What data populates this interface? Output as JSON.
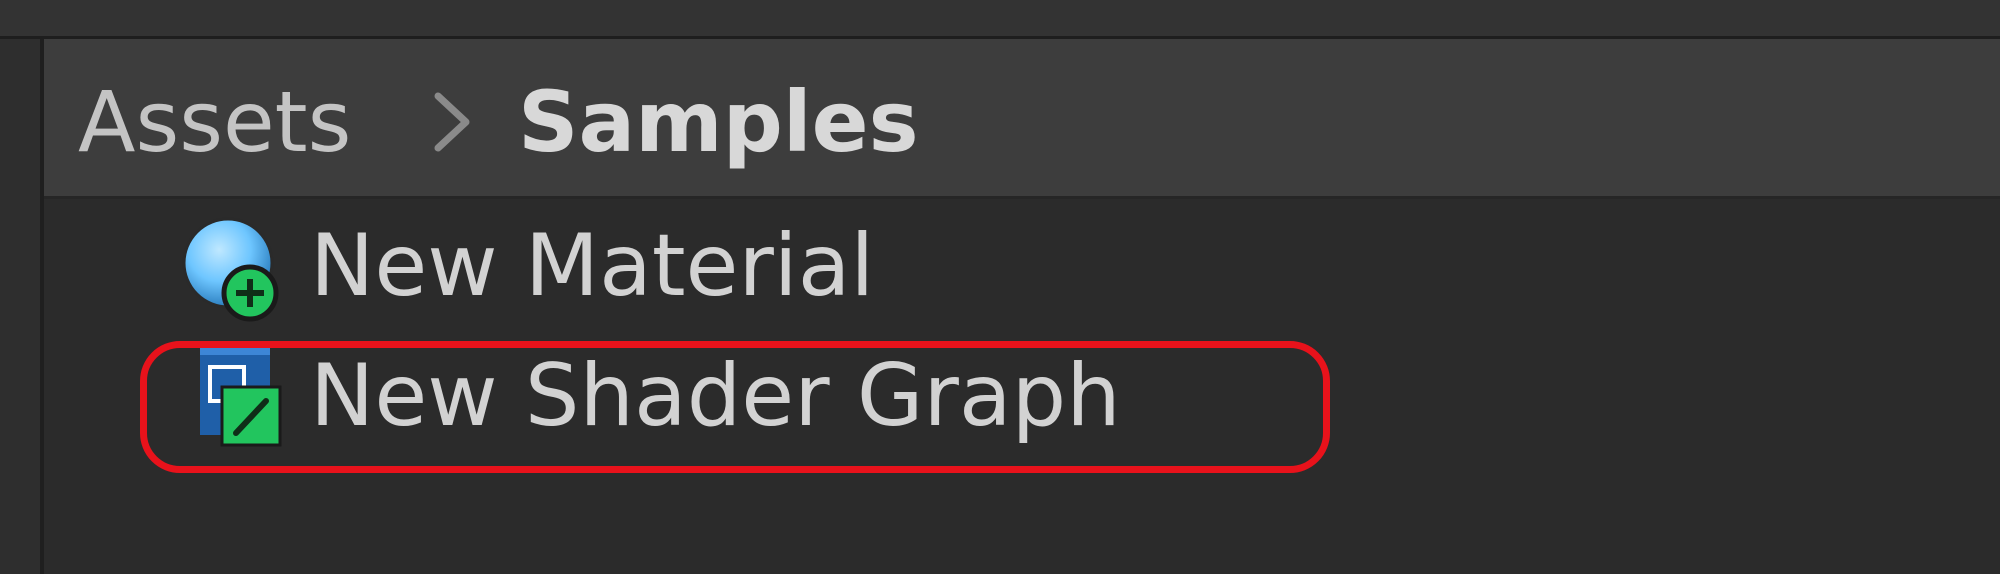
{
  "breadcrumb": {
    "root": "Assets",
    "separator_icon": "chevron-right-icon",
    "current": "Samples"
  },
  "assets": [
    {
      "label": "New Material",
      "icon": "material-sphere-plus-icon"
    },
    {
      "label": "New Shader Graph",
      "icon": "shader-graph-icon"
    }
  ],
  "annotation": {
    "color": "#e8121b",
    "target": "New Shader Graph"
  },
  "colors": {
    "panel_bg": "#2b2b2b",
    "breadcrumb_bg": "#3d3d3d",
    "text": "#d2d2d2",
    "material_blue": "#6ec6ff",
    "shader_green": "#22c55e",
    "shader_blue": "#1f5fa8"
  }
}
